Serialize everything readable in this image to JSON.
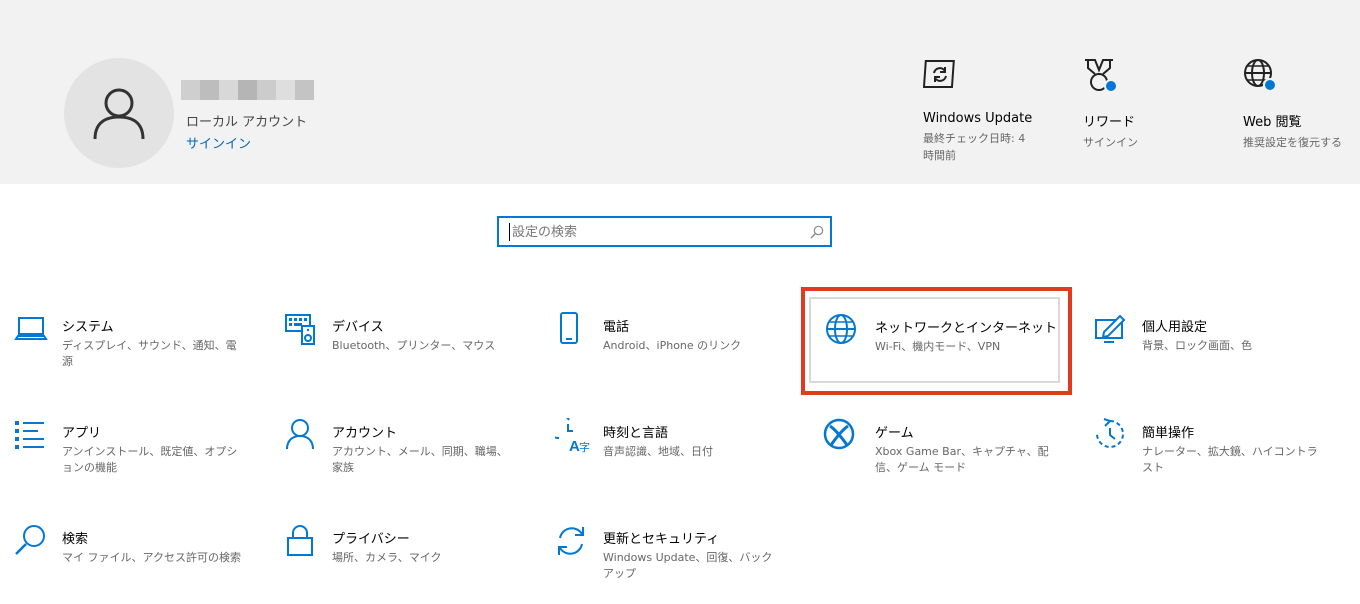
{
  "account": {
    "name_redacted": true,
    "type": "ローカル アカウント",
    "signin_link": "サインイン"
  },
  "quick_actions": [
    {
      "icon": "windows-update-icon",
      "title": "Windows Update",
      "subtitle": "最終チェック日時: 4 時間前"
    },
    {
      "icon": "rewards-trophy-icon",
      "title": "リワード",
      "subtitle": "サインイン"
    },
    {
      "icon": "web-browsing-globe-icon",
      "title": "Web 閲覧",
      "subtitle": "推奨設定を復元する"
    }
  ],
  "search": {
    "placeholder": "設定の検索"
  },
  "categories": [
    {
      "icon": "laptop-icon",
      "title": "システム",
      "desc": "ディスプレイ、サウンド、通知、電源"
    },
    {
      "icon": "keyboard-speaker-icon",
      "title": "デバイス",
      "desc": "Bluetooth、プリンター、マウス"
    },
    {
      "icon": "phone-icon",
      "title": "電話",
      "desc": "Android、iPhone のリンク"
    },
    {
      "icon": "globe-icon",
      "title": "ネットワークとインターネット",
      "desc": "Wi-Fi、機内モード、VPN"
    },
    {
      "icon": "personalization-icon",
      "title": "個人用設定",
      "desc": "背景、ロック画面、色"
    },
    {
      "icon": "apps-list-icon",
      "title": "アプリ",
      "desc": "アンインストール、既定値、オプションの機能"
    },
    {
      "icon": "person-icon",
      "title": "アカウント",
      "desc": "アカウント、メール、同期、職場、家族"
    },
    {
      "icon": "time-language-icon",
      "title": "時刻と言語",
      "desc": "音声認識、地域、日付"
    },
    {
      "icon": "xbox-icon",
      "title": "ゲーム",
      "desc": "Xbox Game Bar、キャプチャ、配信、ゲーム モード"
    },
    {
      "icon": "ease-of-access-icon",
      "title": "簡単操作",
      "desc": "ナレーター、拡大鏡、ハイコントラスト"
    },
    {
      "icon": "search-icon",
      "title": "検索",
      "desc": "マイ ファイル、アクセス許可の検索"
    },
    {
      "icon": "lock-icon",
      "title": "プライバシー",
      "desc": "場所、カメラ、マイク"
    },
    {
      "icon": "sync-arrows-icon",
      "title": "更新とセキュリティ",
      "desc": "Windows Update、回復、バックアップ"
    }
  ],
  "colors": {
    "accent": "#0078d4",
    "highlight": "#e03a21",
    "header_bg": "#f2f2f2"
  }
}
